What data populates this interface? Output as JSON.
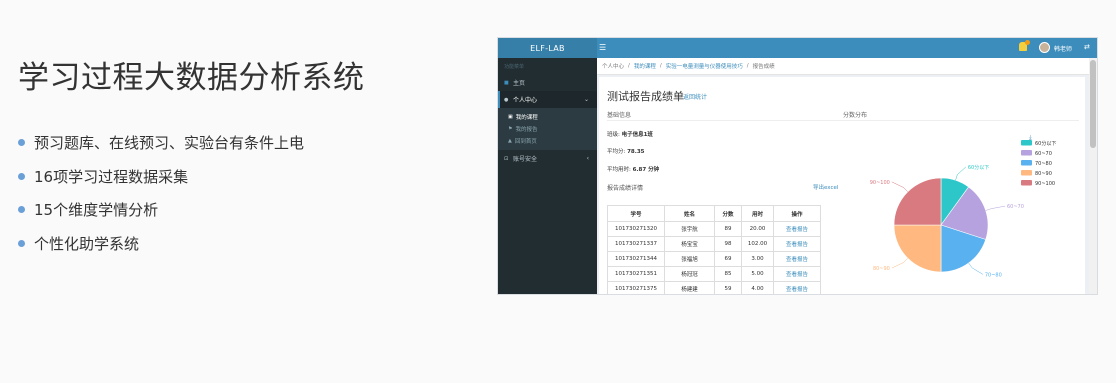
{
  "slide": {
    "title": "学习过程大数据分析系统",
    "bullets": [
      "预习题库、在线预习、实验台有条件上电",
      "16项学习过程数据采集",
      "15个维度学情分析",
      "个性化助学系统"
    ]
  },
  "app": {
    "logo": "ELF-LAB",
    "menu_icon": "☰",
    "user": "韩老师",
    "sidebar": {
      "header": "功能菜单",
      "items": [
        {
          "label": "主页",
          "icon": "home-icon"
        },
        {
          "label": "个人中心",
          "icon": "user-icon"
        },
        {
          "label": "账号安全",
          "icon": "lock-icon"
        }
      ],
      "sub_items": [
        "我的课程",
        "我的报告",
        "回到首页"
      ]
    },
    "breadcrumb": [
      "个人中心",
      "我的课程",
      "实验一电量测量与仪器使用技巧",
      "报告成绩"
    ],
    "card": {
      "title": "测试报告成绩单",
      "sub_link": "返回统计",
      "basic_info": "基础信息",
      "distribution": "分数分布",
      "class_label": "班级:",
      "class_value": "电子信息1班",
      "avg_label": "平均分:",
      "avg_value": "78.35",
      "time_label": "平均用时:",
      "time_value": "6.87 分钟",
      "report_detail": "报告成绩详情",
      "export": "导出excel"
    },
    "table": {
      "headers": [
        "学号",
        "姓名",
        "分数",
        "用时",
        "操作"
      ],
      "rows": [
        [
          "101730271320",
          "张宇航",
          "89",
          "20.00",
          "查看报告"
        ],
        [
          "101730271337",
          "杨宝宝",
          "98",
          "102.00",
          "查看报告"
        ],
        [
          "101730271344",
          "张福旭",
          "69",
          "3.00",
          "查看报告"
        ],
        [
          "101730271351",
          "杨冠冠",
          "85",
          "5.00",
          "查看报告"
        ],
        [
          "101730271375",
          "杨建建",
          "59",
          "4.00",
          "查看报告"
        ]
      ]
    },
    "colors": {
      "topbar": "#3c8dbc",
      "sidebar": "#222d32",
      "link": "#3c8dbc"
    }
  },
  "chart_data": {
    "type": "pie",
    "categories": [
      "60分以下",
      "60~70",
      "70~80",
      "80~90",
      "90~100"
    ],
    "values": [
      10,
      20,
      20,
      25,
      25
    ],
    "colors": [
      "#2ec7c9",
      "#b6a2de",
      "#5ab1ef",
      "#ffb980",
      "#d87a80"
    ],
    "slice_labels": [
      "60分以下",
      "60~70",
      "70~80",
      "80~90",
      "90~100"
    ],
    "legend_position": "top-right"
  }
}
